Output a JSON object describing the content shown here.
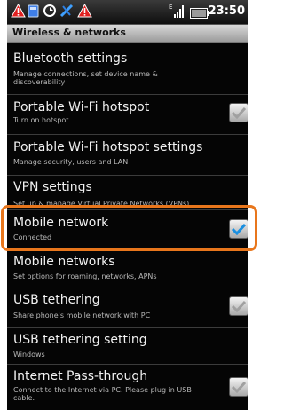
{
  "status_bar": {
    "time": "23:50",
    "icons": [
      "warning-icon",
      "sd-card-icon",
      "sync-icon",
      "music-icon",
      "warning-icon",
      "signal-icon",
      "battery-icon"
    ]
  },
  "header": {
    "title": "Wireless & networks"
  },
  "settings": [
    {
      "title": "Bluetooth settings",
      "subtitle": "Manage connections, set device name & discoverability",
      "checkbox": null
    },
    {
      "title": "Portable Wi-Fi hotspot",
      "subtitle": "Turn on hotspot",
      "checkbox": "checked-gray"
    },
    {
      "title": "Portable Wi-Fi hotspot settings",
      "subtitle": "Manage security, users and LAN",
      "checkbox": null
    },
    {
      "title": "VPN settings",
      "subtitle": "Set up & manage Virtual Private Networks (VPNs)",
      "checkbox": null
    },
    {
      "title": "Mobile network",
      "subtitle": "Connected",
      "checkbox": "checked-blue"
    },
    {
      "title": "Mobile networks",
      "subtitle": "Set options for roaming, networks, APNs",
      "checkbox": null
    },
    {
      "title": "USB tethering",
      "subtitle": "Share phone's mobile network with PC",
      "checkbox": "checked-gray"
    },
    {
      "title": "USB tethering setting",
      "subtitle": "Windows",
      "checkbox": null
    },
    {
      "title": "Internet Pass-through",
      "subtitle": "Connect to the Internet via PC. Please plug in USB cable.",
      "checkbox": "checked-gray"
    }
  ],
  "colors": {
    "highlight": "#e8761c",
    "check_blue": "#1a8fe0",
    "check_gray": "#a0a0a0"
  }
}
